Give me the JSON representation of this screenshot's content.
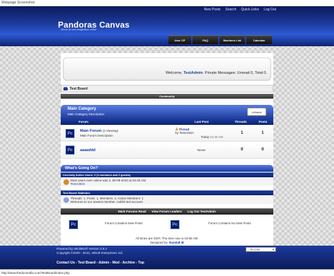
{
  "window": {
    "caption": "Webpage Screenshot"
  },
  "header": {
    "logo": "Pandoras Canvas",
    "tagline": "Where art and imagination collide",
    "topnav": [
      "New Posts",
      "Search",
      "Quick Links",
      "Log Out"
    ],
    "tabs": [
      "User CP",
      "FAQ",
      "Members List",
      "Calendar"
    ]
  },
  "welcome": {
    "prefix": "Welcome, ",
    "user": "TestAdmin",
    "messages": ". Private Messages: Unread 0, Total 0."
  },
  "breadcrumb": {
    "board": "Test Board",
    "community": "Community"
  },
  "category": {
    "title": "Main Category",
    "description": "Main Category Description",
    "collapse_label": "collapse",
    "columns": {
      "forum": "Forum",
      "last_post": "Last Post",
      "threads": "Threads",
      "posts": "Posts"
    }
  },
  "forums": [
    {
      "icon": "Pc",
      "name": "Main Forum",
      "viewing": "(2 Viewing)",
      "description": "Main Forum Description",
      "last_thread": "Thread",
      "last_by": "by TestAdmin",
      "last_date": "Today",
      "last_time": "04:39 AM",
      "threads": "1",
      "posts": "1"
    },
    {
      "icon": "Pc",
      "name": "aaaaddd",
      "last_never": "Never",
      "threads": "0",
      "posts": "0"
    }
  ],
  "whats_going_on": {
    "title": "What's Going On?",
    "active_users_header": "Currently Active Users: 3 (1 members and 2 guests)",
    "most_users": "Most users ever online was 4, 06-09-2010 at 04:40 AM.",
    "active_user": "TestAdmin",
    "stats_header": "Test Board Statistics",
    "stats_line": "Threads: 1, Posts: 1, Members: 2, Active Members: 1",
    "newest_member": "Welcome to our newest member, nubbit test account"
  },
  "links_bar": [
    "Mark Forums Read",
    "View Forum Leaders",
    "Log Out TestAdmin"
  ],
  "legend": [
    {
      "icon": "Pc",
      "label": "Forum Contains New Posts"
    },
    {
      "icon": "Pc",
      "label": "Forum Contains No New Posts"
    }
  ],
  "time_note": "All times are GMT. The time now is 04:55 AM.",
  "designed_by": {
    "prefix": "Designed by: ",
    "name": "Randall M"
  },
  "footer": {
    "powered_by": "Powered by vBulletin® Version 3.8.4",
    "copyright": "Copyright ©2000 - 2010, Jelsoft Enterprises Ltd.",
    "links": "Contact Us - Test Board - Admin - Mod - Archive - Top",
    "style_select": "-- Pc CS4"
  },
  "statusbar": {
    "url": "http://www.thedoomafia.com/TestBoard/index.php"
  },
  "colors": {
    "brand_dark": "#0b1a5a",
    "brand": "#1d3c9e",
    "brand_light": "#5a7ce0"
  }
}
